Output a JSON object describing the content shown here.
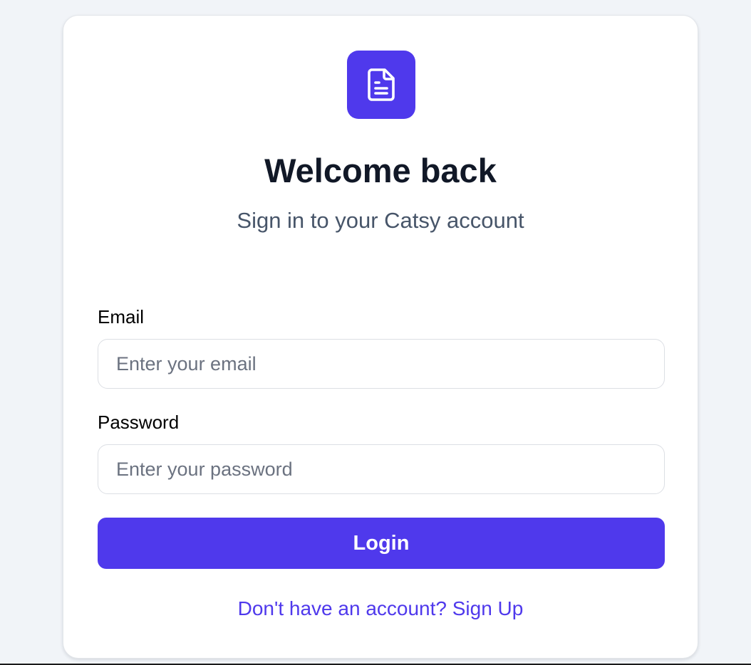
{
  "logo": {
    "icon": "document-icon",
    "background": "#4f39ec"
  },
  "header": {
    "title": "Welcome back",
    "subtitle": "Sign in to your Catsy account"
  },
  "form": {
    "email": {
      "label": "Email",
      "placeholder": "Enter your email",
      "value": ""
    },
    "password": {
      "label": "Password",
      "placeholder": "Enter your password",
      "value": ""
    },
    "submit_label": "Login"
  },
  "footer": {
    "signup_text": "Don't have an account? Sign Up"
  },
  "colors": {
    "accent": "#4f39ec",
    "background": "#f1f4f8",
    "title": "#111827",
    "subtitle": "#475569"
  }
}
